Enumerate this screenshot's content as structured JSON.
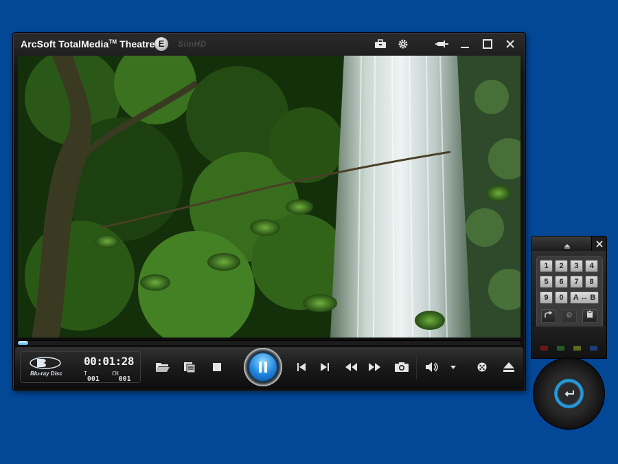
{
  "app": {
    "brand": "ArcSoft TotalMedia",
    "product": "Theatre",
    "trademark": "TM",
    "edition": "E",
    "simhd": "SimHD"
  },
  "titlebar": {
    "icons": [
      "toolbox-icon",
      "gear-icon",
      "pin-icon",
      "minimize-icon",
      "maximize-icon",
      "close-icon"
    ]
  },
  "playback": {
    "time": "00:01:28",
    "title_label": "T",
    "title_value": "001",
    "chapter_label": "CH",
    "chapter_value": "001",
    "progress": 0.02,
    "disc_logo": "Blu-ray Disc"
  },
  "controls": {
    "icons": [
      "open-folder-icon",
      "playlist-icon",
      "stop-icon",
      "pause-icon",
      "previous-icon",
      "next-icon",
      "rewind-icon",
      "fast-forward-icon",
      "snapshot-icon",
      "volume-icon",
      "volume-dropdown-icon",
      "remote-icon",
      "eject-icon"
    ]
  },
  "remote": {
    "keys": [
      "1",
      "2",
      "3",
      "4",
      "5",
      "6",
      "7",
      "8",
      "9",
      "0"
    ],
    "ab_repeat": "A ↔ B",
    "color_buttons": [
      "#6a1616",
      "#245a24",
      "#5d6a1e",
      "#1e3c73"
    ],
    "accent": "#2aa6e8"
  },
  "colors": {
    "desktop": "#034797",
    "accent": "#2b8fe0"
  }
}
